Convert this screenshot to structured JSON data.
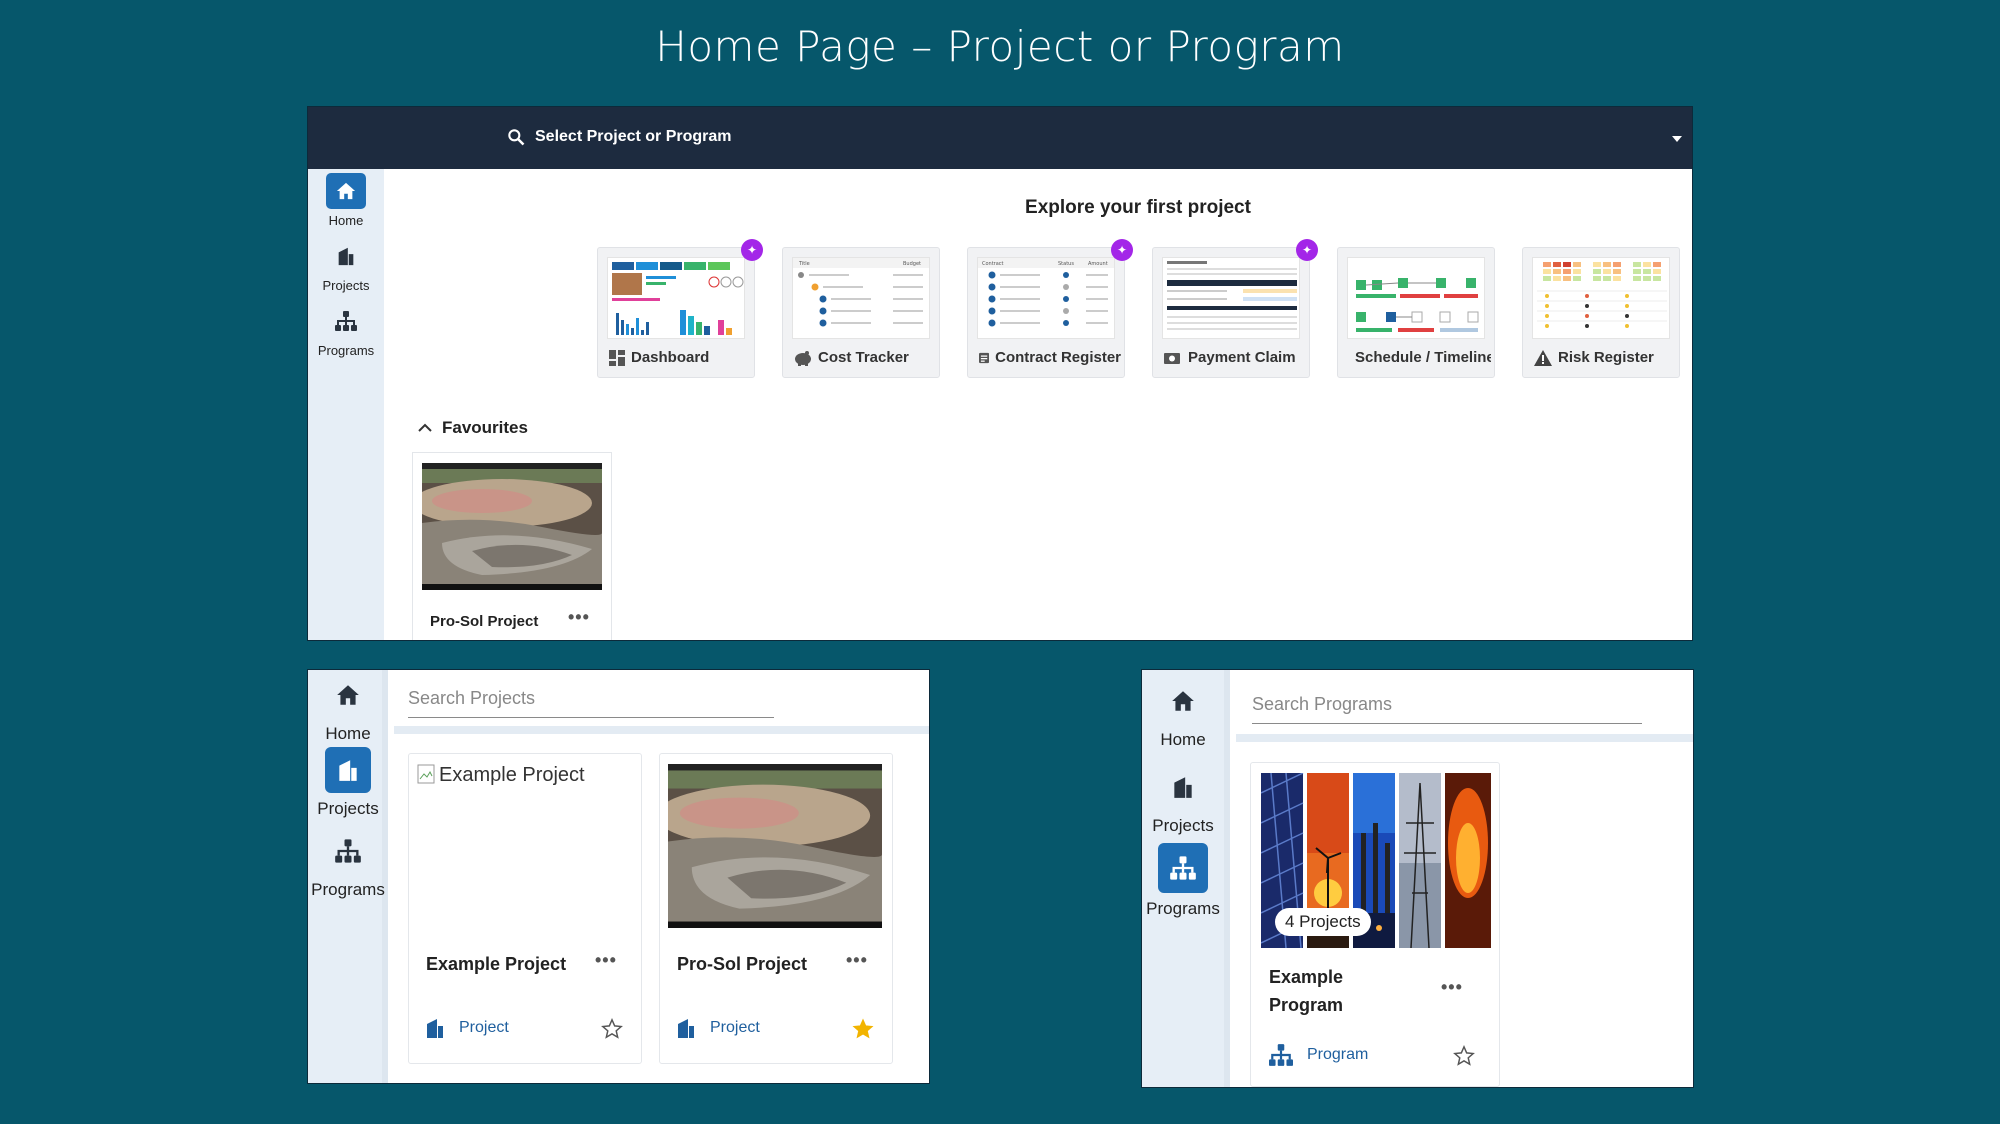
{
  "page_title": "Home Page – Project or Program",
  "top": {
    "select_label": "Select Project or Program",
    "nav": [
      "Home",
      "Projects",
      "Programs"
    ],
    "explore_title": "Explore your first project",
    "tools": [
      {
        "label": "Dashboard",
        "ai": true
      },
      {
        "label": "Cost Tracker",
        "ai": false
      },
      {
        "label": "Contract Register",
        "ai": true
      },
      {
        "label": "Payment Claim",
        "ai": true
      },
      {
        "label": "Schedule / Timeline",
        "ai": false
      },
      {
        "label": "Risk Register",
        "ai": false
      }
    ],
    "favourites_title": "Favourites",
    "favourite_item": "Pro-Sol Project"
  },
  "projects_view": {
    "nav": [
      "Home",
      "Projects",
      "Programs"
    ],
    "search_placeholder": "Search Projects",
    "cards": [
      {
        "name": "Example Project",
        "type": "Project",
        "alt": "Example Project",
        "favourite": false
      },
      {
        "name": "Pro-Sol Project",
        "type": "Project",
        "favourite": true
      }
    ]
  },
  "programs_view": {
    "nav": [
      "Home",
      "Projects",
      "Programs"
    ],
    "search_placeholder": "Search Programs",
    "card": {
      "name_line1": "Example",
      "name_line2": "Program",
      "type": "Program",
      "count": "4 Projects",
      "favourite": false
    }
  },
  "colors": {
    "background": "#06576b",
    "topbar": "#1d2b3f",
    "accent": "#1f6fb5",
    "ai_badge": "#a326e8",
    "star": "#f2b400"
  }
}
